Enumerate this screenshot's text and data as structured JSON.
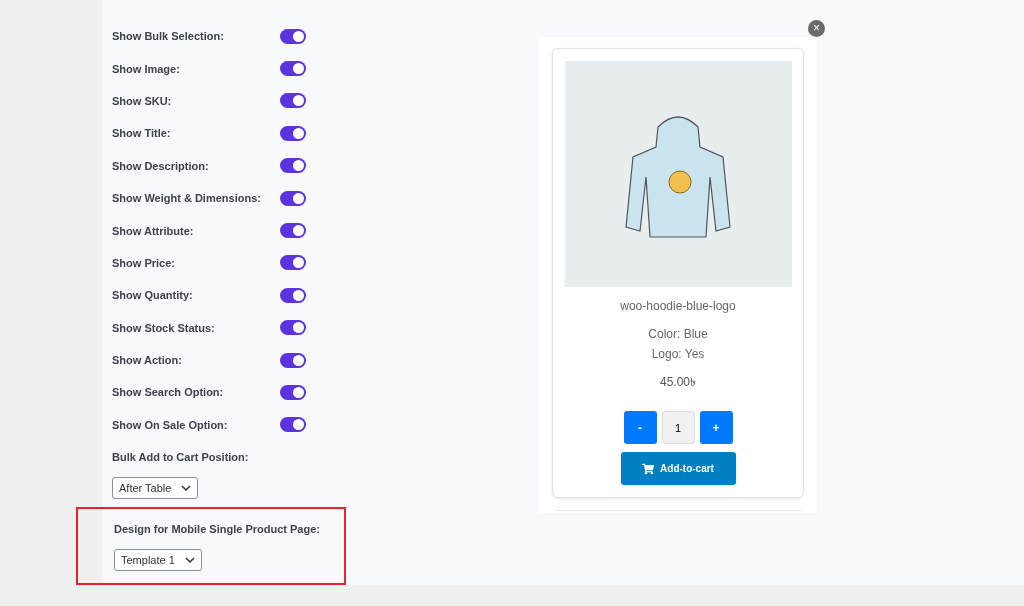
{
  "settings": [
    {
      "label": "Show Bulk Selection:",
      "on": true
    },
    {
      "label": "Show Image:",
      "on": true
    },
    {
      "label": "Show SKU:",
      "on": true
    },
    {
      "label": "Show Title:",
      "on": true
    },
    {
      "label": "Show Description:",
      "on": true
    },
    {
      "label": "Show Weight & Dimensions:",
      "on": true
    },
    {
      "label": "Show Attribute:",
      "on": true
    },
    {
      "label": "Show Price:",
      "on": true
    },
    {
      "label": "Show Quantity:",
      "on": true
    },
    {
      "label": "Show Stock Status:",
      "on": true
    },
    {
      "label": "Show Action:",
      "on": true
    },
    {
      "label": "Show Search Option:",
      "on": true
    },
    {
      "label": "Show On Sale Option:",
      "on": true
    }
  ],
  "selects": [
    {
      "label": "Bulk Add to Cart Position:",
      "value": "After Table",
      "highlighted": false
    },
    {
      "label": "Design for Mobile Single Product Page:",
      "value": "Template 1",
      "highlighted": true
    }
  ],
  "preview": {
    "close": "×",
    "product": {
      "name": "woo-hoodie-blue-logo",
      "attributes": [
        "Color: Blue",
        "Logo: Yes"
      ],
      "price": "45.00৳",
      "minus": "-",
      "quantity": "1",
      "plus": "+",
      "add_to_cart": "Add-to-cart"
    }
  }
}
